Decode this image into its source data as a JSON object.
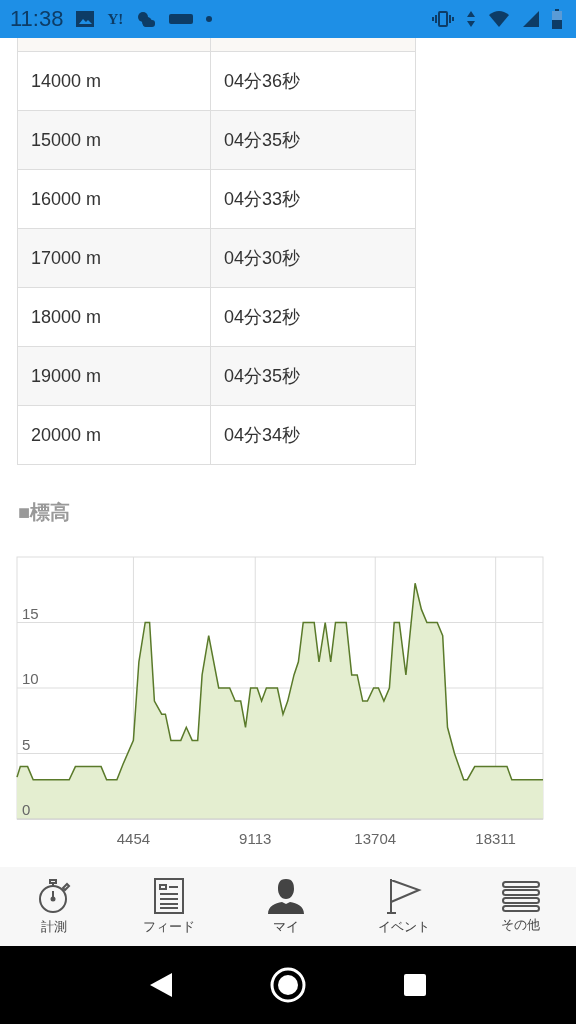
{
  "status_bar": {
    "time": "11:38",
    "notification_text": "Y!"
  },
  "splits": [
    {
      "distance": "14000 m",
      "pace": "04分36秒"
    },
    {
      "distance": "15000 m",
      "pace": "04分35秒"
    },
    {
      "distance": "16000 m",
      "pace": "04分33秒"
    },
    {
      "distance": "17000 m",
      "pace": "04分30秒"
    },
    {
      "distance": "18000 m",
      "pace": "04分32秒"
    },
    {
      "distance": "19000 m",
      "pace": "04分35秒"
    },
    {
      "distance": "20000 m",
      "pace": "04分34秒"
    }
  ],
  "elevation": {
    "title": "■標高",
    "chart_data": {
      "type": "area",
      "xlim": [
        0,
        20122
      ],
      "ylim": [
        0,
        20
      ],
      "xticks": [
        4454,
        9113,
        13704,
        18311
      ],
      "yticks": [
        0,
        5,
        10,
        15
      ],
      "grid": true,
      "series": [
        {
          "color": "#5a7a2a",
          "x": [
            0,
            126,
            407,
            618,
            1995,
            2234,
            3217,
            3428,
            3822,
            4060,
            4454,
            4664,
            4903,
            5072,
            5255,
            5536,
            5676,
            5887,
            6267,
            6478,
            6703,
            6914,
            7082,
            7335,
            7715,
            8136,
            8347,
            8557,
            8740,
            8937,
            9190,
            9359,
            9541,
            9963,
            10174,
            10357,
            10596,
            10764,
            10947,
            11369,
            11552,
            11791,
            12002,
            12185,
            12592,
            12803,
            13014,
            13225,
            13404,
            13642,
            13825,
            14036,
            14247,
            14429,
            14626,
            14879,
            15231,
            15470,
            15681,
            16074,
            16285,
            16468,
            16735,
            17087,
            17227,
            17508,
            18745,
            18928,
            20122
          ],
          "values": [
            3.2,
            4,
            4,
            3,
            3,
            4,
            4,
            3,
            3,
            4.2,
            6,
            12,
            15,
            15,
            9,
            8,
            8,
            6,
            6,
            7,
            6,
            6,
            11,
            14,
            10,
            10,
            9,
            9,
            7,
            10,
            10,
            9,
            10,
            10,
            8,
            9,
            11,
            12,
            15,
            15,
            12,
            15,
            12,
            15,
            15,
            11,
            11,
            9,
            9,
            10,
            10,
            9,
            10,
            15,
            15,
            11,
            18,
            16,
            15,
            15,
            14,
            7,
            5,
            3,
            3,
            4,
            4,
            3,
            3
          ]
        }
      ]
    }
  },
  "bottom_nav": [
    {
      "kind": "stopwatch",
      "label": "計測"
    },
    {
      "kind": "feed",
      "label": "フィード"
    },
    {
      "kind": "person",
      "label": "マイ"
    },
    {
      "kind": "flag",
      "label": "イベント"
    },
    {
      "kind": "menu",
      "label": "その他"
    }
  ]
}
